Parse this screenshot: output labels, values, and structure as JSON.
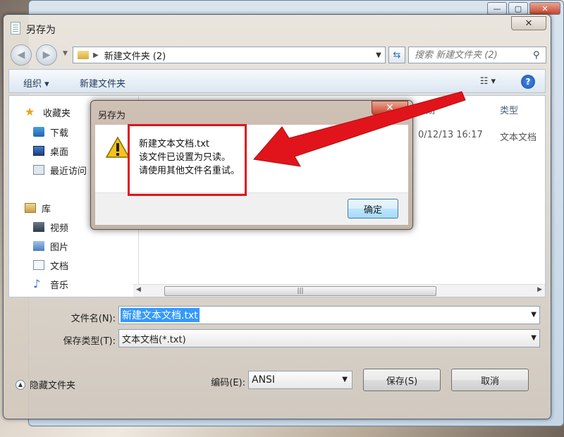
{
  "window": {
    "title": "另存为",
    "close_glyph": "✕"
  },
  "nav": {
    "back_glyph": "◀",
    "forward_glyph": "▶",
    "address_path": "新建文件夹 (2)",
    "search_placeholder": "搜索 新建文件夹 (2)"
  },
  "toolbar": {
    "organize_label": "组织 ▾",
    "new_folder_label": "新建文件夹",
    "view_glyph": "☷ ▾",
    "help_glyph": "?"
  },
  "sidebar": {
    "favorites_label": "收藏夹",
    "items": [
      "下载",
      "桌面",
      "最近访问"
    ],
    "library_label": "库",
    "library_items": [
      "视频",
      "图片",
      "文档",
      "音乐"
    ]
  },
  "filelist": {
    "col_date": "日期",
    "col_type": "类型",
    "row_date": "0/12/13 16:17",
    "row_type": "文本文档"
  },
  "form": {
    "filename_label": "文件名(N):",
    "filename_value": "新建文本文档.txt",
    "filetype_label": "保存类型(T):",
    "filetype_value": "文本文档(*.txt)",
    "encoding_label": "编码(E):",
    "encoding_value": "ANSI",
    "hide_folders_label": "隐藏文件夹",
    "save_label": "保存(S)",
    "cancel_label": "取消"
  },
  "alert": {
    "title": "另存为",
    "line1": "新建文本文档.txt",
    "line2": "该文件已设置为只读。",
    "line3": "请使用其他文件名重试。",
    "ok_label": "确定"
  },
  "colors": {
    "annotation_red": "#e1141b",
    "selection_blue": "#3399ff"
  }
}
